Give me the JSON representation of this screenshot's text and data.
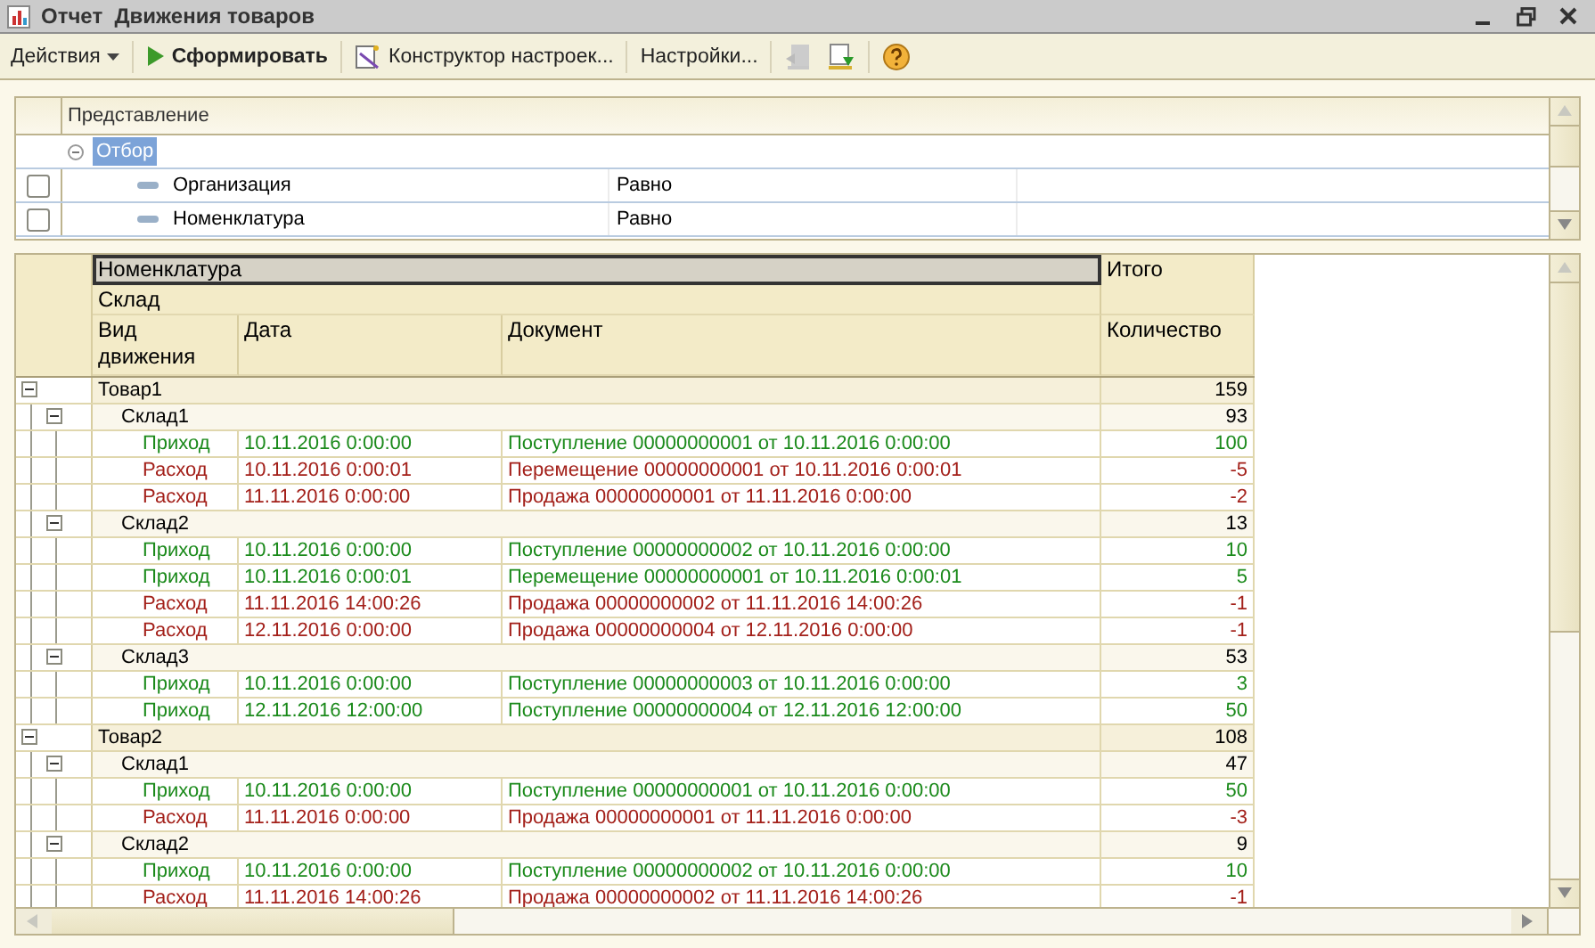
{
  "window": {
    "title": "Отчет  Движения товаров"
  },
  "toolbar": [
    {
      "kind": "menu",
      "label": "Действия",
      "disabled": false
    },
    {
      "kind": "run",
      "label": "Сформировать",
      "disabled": false
    },
    {
      "kind": "wizard",
      "label": "Конструктор настроек...",
      "disabled": false
    },
    {
      "kind": "text",
      "label": "Настройки...",
      "disabled": false
    },
    {
      "kind": "load",
      "disabled": true
    },
    {
      "kind": "save",
      "disabled": false
    },
    {
      "kind": "help",
      "disabled": false
    }
  ],
  "settings": {
    "column": "Представление",
    "group": {
      "label": "Отбор",
      "expanded": true,
      "selected": true
    },
    "rows": [
      {
        "name": "Организация",
        "condition": "Равно",
        "checked": false
      },
      {
        "name": "Номенклатура",
        "condition": "Равно",
        "checked": false
      }
    ]
  },
  "report": {
    "header": {
      "group1": {
        "label": "Номенклатура",
        "selected": true
      },
      "total": "Итого",
      "group2": "Склад",
      "columns": [
        "Вид движения",
        "Дата",
        "Документ",
        "Количество"
      ]
    },
    "children": [
      {
        "name": "Товар1",
        "total": "159",
        "expanded": true,
        "children": [
          {
            "name": "Склад1",
            "total": "93",
            "expanded": true,
            "children": [
              {
                "kind": "income",
                "type": "Приход",
                "date": "10.11.2016 0:00:00",
                "document": "Поступление 00000000001 от 10.11.2016 0:00:00",
                "quantity": "100"
              },
              {
                "kind": "expense",
                "type": "Расход",
                "date": "10.11.2016 0:00:01",
                "document": "Перемещение 00000000001 от 10.11.2016 0:00:01",
                "quantity": "-5"
              },
              {
                "kind": "expense",
                "type": "Расход",
                "date": "11.11.2016 0:00:00",
                "document": "Продажа 00000000001 от 11.11.2016 0:00:00",
                "quantity": "-2"
              }
            ]
          },
          {
            "name": "Склад2",
            "total": "13",
            "expanded": true,
            "children": [
              {
                "kind": "income",
                "type": "Приход",
                "date": "10.11.2016 0:00:00",
                "document": "Поступление 00000000002 от 10.11.2016 0:00:00",
                "quantity": "10"
              },
              {
                "kind": "income",
                "type": "Приход",
                "date": "10.11.2016 0:00:01",
                "document": "Перемещение 00000000001 от 10.11.2016 0:00:01",
                "quantity": "5"
              },
              {
                "kind": "expense",
                "type": "Расход",
                "date": "11.11.2016 14:00:26",
                "document": "Продажа 00000000002 от 11.11.2016 14:00:26",
                "quantity": "-1"
              },
              {
                "kind": "expense",
                "type": "Расход",
                "date": "12.11.2016 0:00:00",
                "document": "Продажа 00000000004 от 12.11.2016 0:00:00",
                "quantity": "-1"
              }
            ]
          },
          {
            "name": "Склад3",
            "total": "53",
            "expanded": true,
            "children": [
              {
                "kind": "income",
                "type": "Приход",
                "date": "10.11.2016 0:00:00",
                "document": "Поступление 00000000003 от 10.11.2016 0:00:00",
                "quantity": "3"
              },
              {
                "kind": "income",
                "type": "Приход",
                "date": "12.11.2016 12:00:00",
                "document": "Поступление 00000000004 от 12.11.2016 12:00:00",
                "quantity": "50"
              }
            ]
          }
        ]
      },
      {
        "name": "Товар2",
        "total": "108",
        "expanded": true,
        "children": [
          {
            "name": "Склад1",
            "total": "47",
            "expanded": true,
            "children": [
              {
                "kind": "income",
                "type": "Приход",
                "date": "10.11.2016 0:00:00",
                "document": "Поступление 00000000001 от 10.11.2016 0:00:00",
                "quantity": "50"
              },
              {
                "kind": "expense",
                "type": "Расход",
                "date": "11.11.2016 0:00:00",
                "document": "Продажа 00000000001 от 11.11.2016 0:00:00",
                "quantity": "-3"
              }
            ]
          },
          {
            "name": "Склад2",
            "total": "9",
            "expanded": true,
            "children": [
              {
                "kind": "income",
                "type": "Приход",
                "date": "10.11.2016 0:00:00",
                "document": "Поступление 00000000002 от 10.11.2016 0:00:00",
                "quantity": "10"
              },
              {
                "kind": "expense",
                "type": "Расход",
                "date": "11.11.2016 14:00:26",
                "document": "Продажа 00000000002 от 11.11.2016 14:00:26",
                "quantity": "-1"
              }
            ]
          }
        ]
      }
    ]
  }
}
